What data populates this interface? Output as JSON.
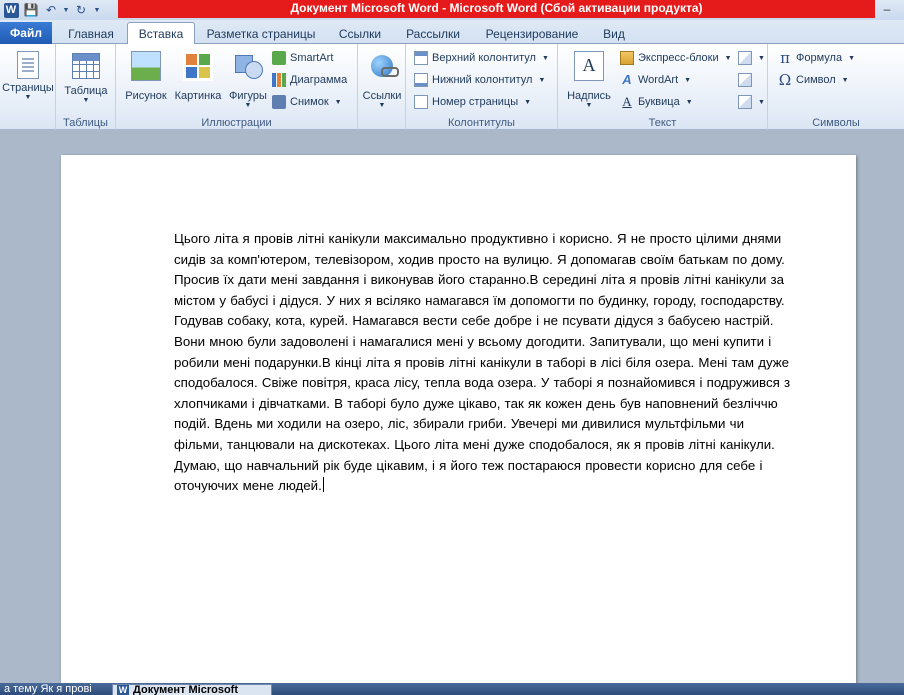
{
  "window": {
    "title": "Документ Microsoft Word  -  Microsoft Word (Сбой активации продукта)",
    "app_icon": "W"
  },
  "qat": {
    "save_icon": "save-icon",
    "undo_icon": "undo-icon",
    "redo_icon": "repeat-icon"
  },
  "tabs": {
    "file": "Файл",
    "items": [
      {
        "label": "Главная"
      },
      {
        "label": "Вставка"
      },
      {
        "label": "Разметка страницы"
      },
      {
        "label": "Ссылки"
      },
      {
        "label": "Рассылки"
      },
      {
        "label": "Рецензирование"
      },
      {
        "label": "Вид"
      }
    ],
    "active": "Вставка"
  },
  "ribbon": {
    "pages": {
      "button": "Страницы"
    },
    "tables": {
      "button": "Таблица",
      "group": "Таблицы"
    },
    "illustrations": {
      "picture": "Рисунок",
      "clipart": "Картинка",
      "shapes": "Фигуры",
      "smartart": "SmartArt",
      "chart": "Диаграмма",
      "screenshot": "Снимок",
      "group": "Иллюстрации"
    },
    "links": {
      "button": "Ссылки"
    },
    "header_footer": {
      "header": "Верхний колонтитул",
      "footer": "Нижний колонтитул",
      "page_number": "Номер страницы",
      "group": "Колонтитулы"
    },
    "text": {
      "textbox": "Надпись",
      "quickparts": "Экспресс-блоки",
      "wordart": "WordArt",
      "dropcap": "Буквица",
      "group": "Текст"
    },
    "symbols": {
      "equation": "Формула",
      "symbol": "Символ",
      "group": "Символы"
    }
  },
  "document": {
    "text": "Цього літа я провів літні канікули максимально продуктивно і корисно. Я не просто цілими днями сидів за комп'ютером, телевізором, ходив просто на вулицю. Я допомагав своїм батькам по дому. Просив їх дати мені завдання і виконував його старанно.В середині літа я провів літні канікули за містом у бабусі і дідуся. У них я всіляко намагався їм допомогти по будинку, городу, господарству. Годував собаку, кота, курей. Намагався вести себе добре і не псувати дідуся з бабусею настрій. Вони мною були задоволені і намагалися мені у всьому догодити. Запитували, що мені купити і робили мені подарунки.В кінці літа я провів літні канікули в таборі в лісі біля озера. Мені там дуже сподобалося. Свіже повітря, краса лісу, тепла вода озера. У таборі я познайомився і подружився з хлопчиками і дівчатками. В таборі було дуже цікаво, так як кожен день був наповнений безліччю подій. Вдень ми ходили на озеро, ліс, збирали гриби. Увечері ми дивилися мультфільми чи фільми, танцювали на дискотеках. Цього літа мені дуже сподобалося, як я провів літні канікули. Думаю, що навчальний рік буде цікавим, і я його теж постараюся провести корисно для себе і оточуючих мене людей."
  },
  "taskbar": {
    "items": [
      {
        "label": "а тему Як я прові"
      },
      {
        "label": "Документ Microsoft"
      }
    ]
  }
}
